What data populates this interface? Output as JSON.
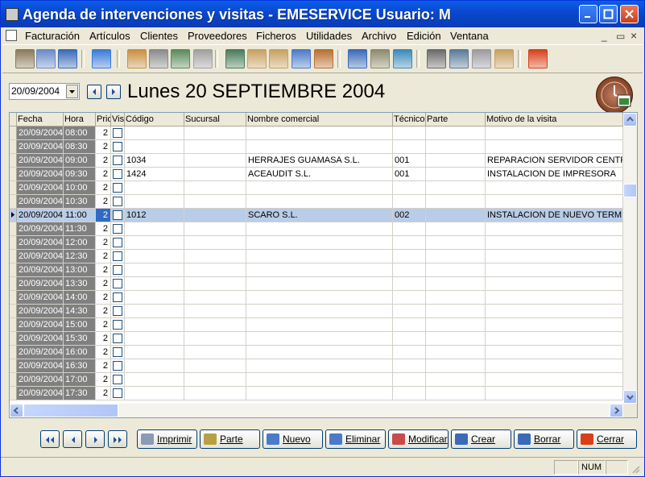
{
  "window": {
    "title": "Agenda de intervenciones y visitas - EMESERVICE Usuario: M"
  },
  "menu": [
    "Facturación",
    "Artículos",
    "Clientes",
    "Proveedores",
    "Ficheros",
    "Utilidades",
    "Archivo",
    "Edición",
    "Ventana"
  ],
  "mdi_controls": {
    "minimize": "_",
    "restore": "▭",
    "close": "×"
  },
  "date_input": {
    "value": "20/09/2004"
  },
  "big_date": "Lunes 20 SEPTIEMBRE 2004",
  "columns": [
    "Fecha",
    "Hora",
    "Prio",
    "Visi",
    "Código",
    "Sucursal",
    "Nombre comercial",
    "Técnico",
    "Parte",
    "Motivo de la visita"
  ],
  "rows": [
    {
      "fecha": "20/09/2004",
      "hora": "08:00",
      "prio": "2",
      "codigo": "",
      "nombre": "",
      "tecnico": "",
      "motivo": ""
    },
    {
      "fecha": "20/09/2004",
      "hora": "08:30",
      "prio": "2",
      "codigo": "",
      "nombre": "",
      "tecnico": "",
      "motivo": ""
    },
    {
      "fecha": "20/09/2004",
      "hora": "09:00",
      "prio": "2",
      "codigo": "1034",
      "nombre": "HERRAJES GUAMASA S.L.",
      "tecnico": "001",
      "motivo": "REPARACION SERVIDOR CENTRAL"
    },
    {
      "fecha": "20/09/2004",
      "hora": "09:30",
      "prio": "2",
      "codigo": "1424",
      "nombre": "ACEAUDIT S.L.",
      "tecnico": "001",
      "motivo": "INSTALACION DE IMPRESORA"
    },
    {
      "fecha": "20/09/2004",
      "hora": "10:00",
      "prio": "2",
      "codigo": "",
      "nombre": "",
      "tecnico": "",
      "motivo": ""
    },
    {
      "fecha": "20/09/2004",
      "hora": "10:30",
      "prio": "2",
      "codigo": "",
      "nombre": "",
      "tecnico": "",
      "motivo": ""
    },
    {
      "fecha": "20/09/2004",
      "hora": "11:00",
      "prio": "2",
      "codigo": "1012",
      "nombre": "SCARO S.L.",
      "tecnico": "002",
      "motivo": "INSTALACION DE NUEVO TERMINAL",
      "selected": true
    },
    {
      "fecha": "20/09/2004",
      "hora": "11:30",
      "prio": "2",
      "codigo": "",
      "nombre": "",
      "tecnico": "",
      "motivo": ""
    },
    {
      "fecha": "20/09/2004",
      "hora": "12:00",
      "prio": "2",
      "codigo": "",
      "nombre": "",
      "tecnico": "",
      "motivo": ""
    },
    {
      "fecha": "20/09/2004",
      "hora": "12:30",
      "prio": "2",
      "codigo": "",
      "nombre": "",
      "tecnico": "",
      "motivo": ""
    },
    {
      "fecha": "20/09/2004",
      "hora": "13:00",
      "prio": "2",
      "codigo": "",
      "nombre": "",
      "tecnico": "",
      "motivo": ""
    },
    {
      "fecha": "20/09/2004",
      "hora": "13:30",
      "prio": "2",
      "codigo": "",
      "nombre": "",
      "tecnico": "",
      "motivo": ""
    },
    {
      "fecha": "20/09/2004",
      "hora": "14:00",
      "prio": "2",
      "codigo": "",
      "nombre": "",
      "tecnico": "",
      "motivo": ""
    },
    {
      "fecha": "20/09/2004",
      "hora": "14:30",
      "prio": "2",
      "codigo": "",
      "nombre": "",
      "tecnico": "",
      "motivo": ""
    },
    {
      "fecha": "20/09/2004",
      "hora": "15:00",
      "prio": "2",
      "codigo": "",
      "nombre": "",
      "tecnico": "",
      "motivo": ""
    },
    {
      "fecha": "20/09/2004",
      "hora": "15:30",
      "prio": "2",
      "codigo": "",
      "nombre": "",
      "tecnico": "",
      "motivo": ""
    },
    {
      "fecha": "20/09/2004",
      "hora": "16:00",
      "prio": "2",
      "codigo": "",
      "nombre": "",
      "tecnico": "",
      "motivo": ""
    },
    {
      "fecha": "20/09/2004",
      "hora": "16:30",
      "prio": "2",
      "codigo": "",
      "nombre": "",
      "tecnico": "",
      "motivo": ""
    },
    {
      "fecha": "20/09/2004",
      "hora": "17:00",
      "prio": "2",
      "codigo": "",
      "nombre": "",
      "tecnico": "",
      "motivo": ""
    },
    {
      "fecha": "20/09/2004",
      "hora": "17:30",
      "prio": "2",
      "codigo": "",
      "nombre": "",
      "tecnico": "",
      "motivo": ""
    }
  ],
  "pager_icons": [
    "first-icon",
    "prev-icon",
    "next-icon",
    "last-icon"
  ],
  "actions": [
    {
      "label": "Imprimir",
      "icon": "printer-icon",
      "color": "#8a9bb5"
    },
    {
      "label": "Parte",
      "icon": "gear-icon",
      "color": "#b8a040"
    },
    {
      "label": "Nuevo",
      "icon": "plus-icon",
      "color": "#4a7ac8"
    },
    {
      "label": "Eliminar",
      "icon": "minus-icon",
      "color": "#4a7ac8"
    },
    {
      "label": "Modificar",
      "icon": "pencil-icon",
      "color": "#c84a4a"
    },
    {
      "label": "Crear",
      "icon": "calendar-add-icon",
      "color": "#3a6ab8"
    },
    {
      "label": "Borrar",
      "icon": "calendar-delete-icon",
      "color": "#3a6ab8"
    },
    {
      "label": "Cerrar",
      "icon": "power-icon",
      "color": "#d8401a"
    }
  ],
  "status": {
    "num": "NUM"
  },
  "toolbar_icons": [
    "book-icon",
    "users-icon",
    "globe-icon",
    "home-icon",
    "people-icon",
    "gears-icon",
    "calculator-icon",
    "clock-icon",
    "computer-icon",
    "user-card-icon",
    "user-list-icon",
    "network-icon",
    "briefcase-icon",
    "globe2-icon",
    "box-icon",
    "web-icon",
    "tools-icon",
    "book2-icon",
    "printer-icon",
    "user-edit-icon",
    "power-icon"
  ]
}
